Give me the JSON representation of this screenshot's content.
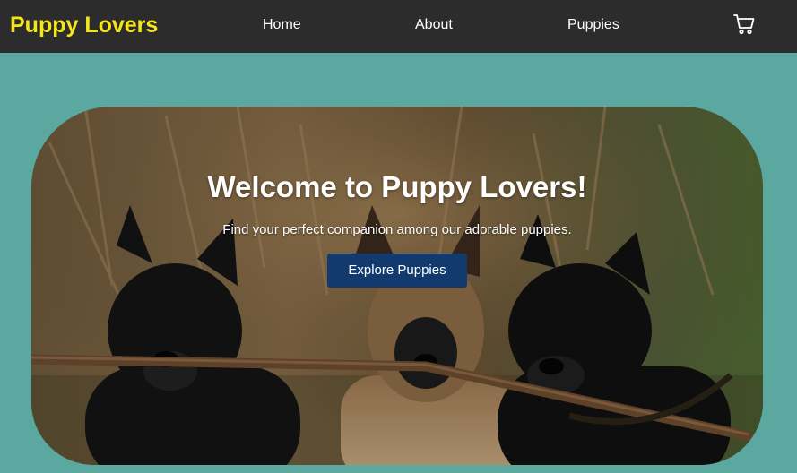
{
  "navbar": {
    "brand": "Puppy Lovers",
    "links": [
      {
        "label": "Home"
      },
      {
        "label": "About"
      },
      {
        "label": "Puppies"
      }
    ],
    "cart_icon": "shopping-cart-icon"
  },
  "hero": {
    "title": "Welcome to Puppy Lovers!",
    "subtitle": "Find your perfect companion among our adorable puppies.",
    "button_label": "Explore Puppies",
    "image": "three-puppies-holding-stick-photo"
  },
  "colors": {
    "page_background": "#5aa8a0",
    "navbar_background": "#2c2c2c",
    "brand": "#f5e61b",
    "nav_text": "#ffffff",
    "button_background": "#123a6e"
  }
}
